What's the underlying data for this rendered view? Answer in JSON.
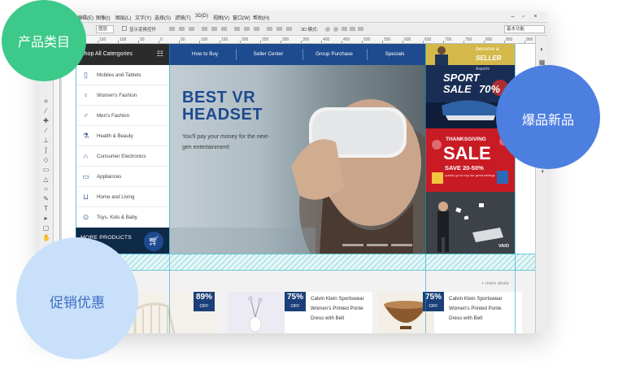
{
  "bubbles": {
    "categories": "产品类目",
    "new_hot": "爆品新品",
    "promotions": "促销优惠"
  },
  "app": {
    "menu": [
      "编辑(E)",
      "图像(I)",
      "图层(L)",
      "文字(Y)",
      "选择(S)",
      "滤镜(T)",
      "3D(D)",
      "视图(V)",
      "窗口(W)",
      "帮助(H)"
    ],
    "options": {
      "auto_select_value": "图层",
      "show_transform_label": "显示变换控件",
      "mode_label": "3D 模式:",
      "workspace": "基本功能"
    },
    "ruler_ticks": [
      "250",
      "200",
      "150",
      "100",
      "50",
      "0",
      "50",
      "100",
      "150",
      "200",
      "250",
      "300",
      "350",
      "400",
      "450",
      "500",
      "550",
      "600",
      "650",
      "700",
      "750",
      "800",
      "850",
      "900"
    ]
  },
  "site": {
    "category_header": "Shop All Catergories",
    "nav": [
      "How to Buy",
      "Seller Center",
      "Group Purchase",
      "Specials"
    ],
    "categories": [
      {
        "label": "Mobiles and Tablets",
        "icon": "mobile-icon"
      },
      {
        "label": "Women's Fashion",
        "icon": "dress-icon"
      },
      {
        "label": "Men's Fashion",
        "icon": "shirt-icon"
      },
      {
        "label": "Health & Beauty",
        "icon": "beauty-bottle-icon"
      },
      {
        "label": "Consumer Electronics",
        "icon": "headphones-icon"
      },
      {
        "label": "Appliances",
        "icon": "monitor-icon"
      },
      {
        "label": "Home and Living",
        "icon": "sofa-icon"
      },
      {
        "label": "Toys, Kids & Baby",
        "icon": "stroller-icon"
      }
    ],
    "more_products": "MORE PRODUCTS",
    "hero": {
      "title": "BEST VR HEADSET",
      "subtitle": "You'll pay your money for the next-gen  entertainment!"
    },
    "banners": {
      "seller": {
        "line1": "become a",
        "line2": "SELLER"
      },
      "sport": {
        "brand": "Asports",
        "tag": "SPORT",
        "sale": "SALE",
        "pct": "70%"
      },
      "thanks": {
        "top": "THANKSGIVING",
        "sale": "SALE",
        "pct": "SAVE 20-50%",
        "small": "quickly go to buy our great savings"
      },
      "vaio": {
        "brand": "VAIO"
      }
    },
    "deals": {
      "more": "+ more deals",
      "cards": [
        {
          "discount": "89%",
          "off": "OFF",
          "desc": []
        },
        {
          "discount": "75%",
          "off": "OFF",
          "desc": [
            "Calvin Klein Sportswear",
            "Women's Printed Ponte",
            "Dress with Belt"
          ]
        },
        {
          "discount": "75%",
          "off": "OFF",
          "desc": [
            "Calvin Klein Sportswear",
            "Women's Printed Ponte",
            "Dress with Belt"
          ]
        }
      ]
    }
  },
  "colors": {
    "green": "#3cc98a",
    "blue": "#4d7fe0",
    "lightblue": "#c9e0fa",
    "navy": "#1e4a8f"
  }
}
